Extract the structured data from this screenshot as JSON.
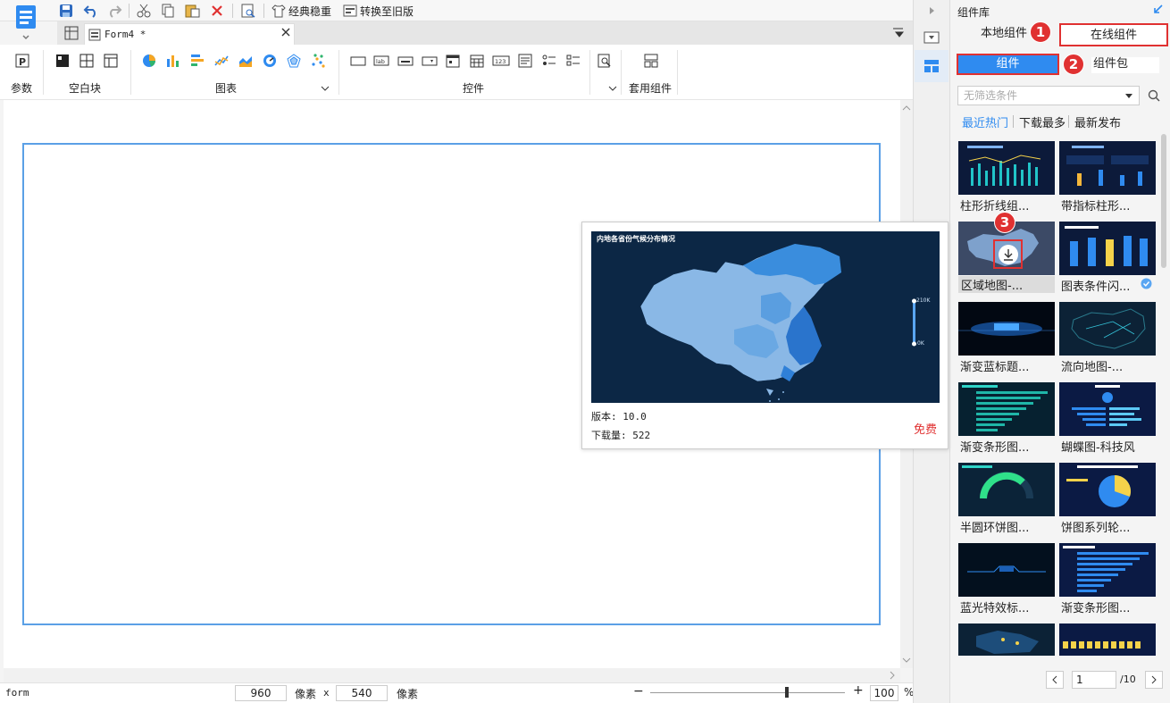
{
  "toolbar": {
    "classic_label": "经典稳重",
    "convert_label": "转换至旧版"
  },
  "doc_tab": {
    "title": "Form4 *"
  },
  "ribbon": {
    "params_label": "参数",
    "blank_label": "空白块",
    "chart_label": "图表",
    "control_label": "控件",
    "apply_label": "套用组件",
    "control_icon_text": [
      "lab",
      "123"
    ]
  },
  "status": {
    "name": "form",
    "width": "960",
    "unit1": "像素",
    "times": "x",
    "height": "540",
    "unit2": "像素",
    "zoom": "100",
    "percent": "%",
    "zoom_level": 0.7
  },
  "panel": {
    "title": "组件库",
    "tab_local": "本地组件",
    "tab_online": "在线组件",
    "btn_component": "组件",
    "btn_package": "组件包",
    "filter_placeholder": "无筛选条件",
    "sort_hot": "最近热门",
    "sort_download": "下载最多",
    "sort_new": "最新发布",
    "items": [
      {
        "label": "柱形折线组..."
      },
      {
        "label": "带指标柱形..."
      },
      {
        "label": "区域地图-..."
      },
      {
        "label": "图表条件闪..."
      },
      {
        "label": "渐变蓝标题..."
      },
      {
        "label": "流向地图-..."
      },
      {
        "label": "渐变条形图..."
      },
      {
        "label": "蝴蝶图-科技风"
      },
      {
        "label": "半圆环饼图..."
      },
      {
        "label": "饼图系列轮..."
      },
      {
        "label": "蓝光特效标..."
      },
      {
        "label": "渐变条形图..."
      }
    ],
    "page_current": "1",
    "page_total": "/10",
    "badges": [
      "1",
      "2",
      "3"
    ]
  },
  "popup": {
    "map_title": "内地各省份气候分布情况",
    "legend_max": "210K",
    "legend_min": "0K",
    "version_label": "版本: 10.0",
    "downloads_label": "下载量: 522",
    "price": "免费"
  },
  "colors": {
    "accent": "#2f8bf0",
    "badge": "#e03131",
    "frame": "#5ba0e6",
    "thumb_dark": "#0c1a3a"
  }
}
